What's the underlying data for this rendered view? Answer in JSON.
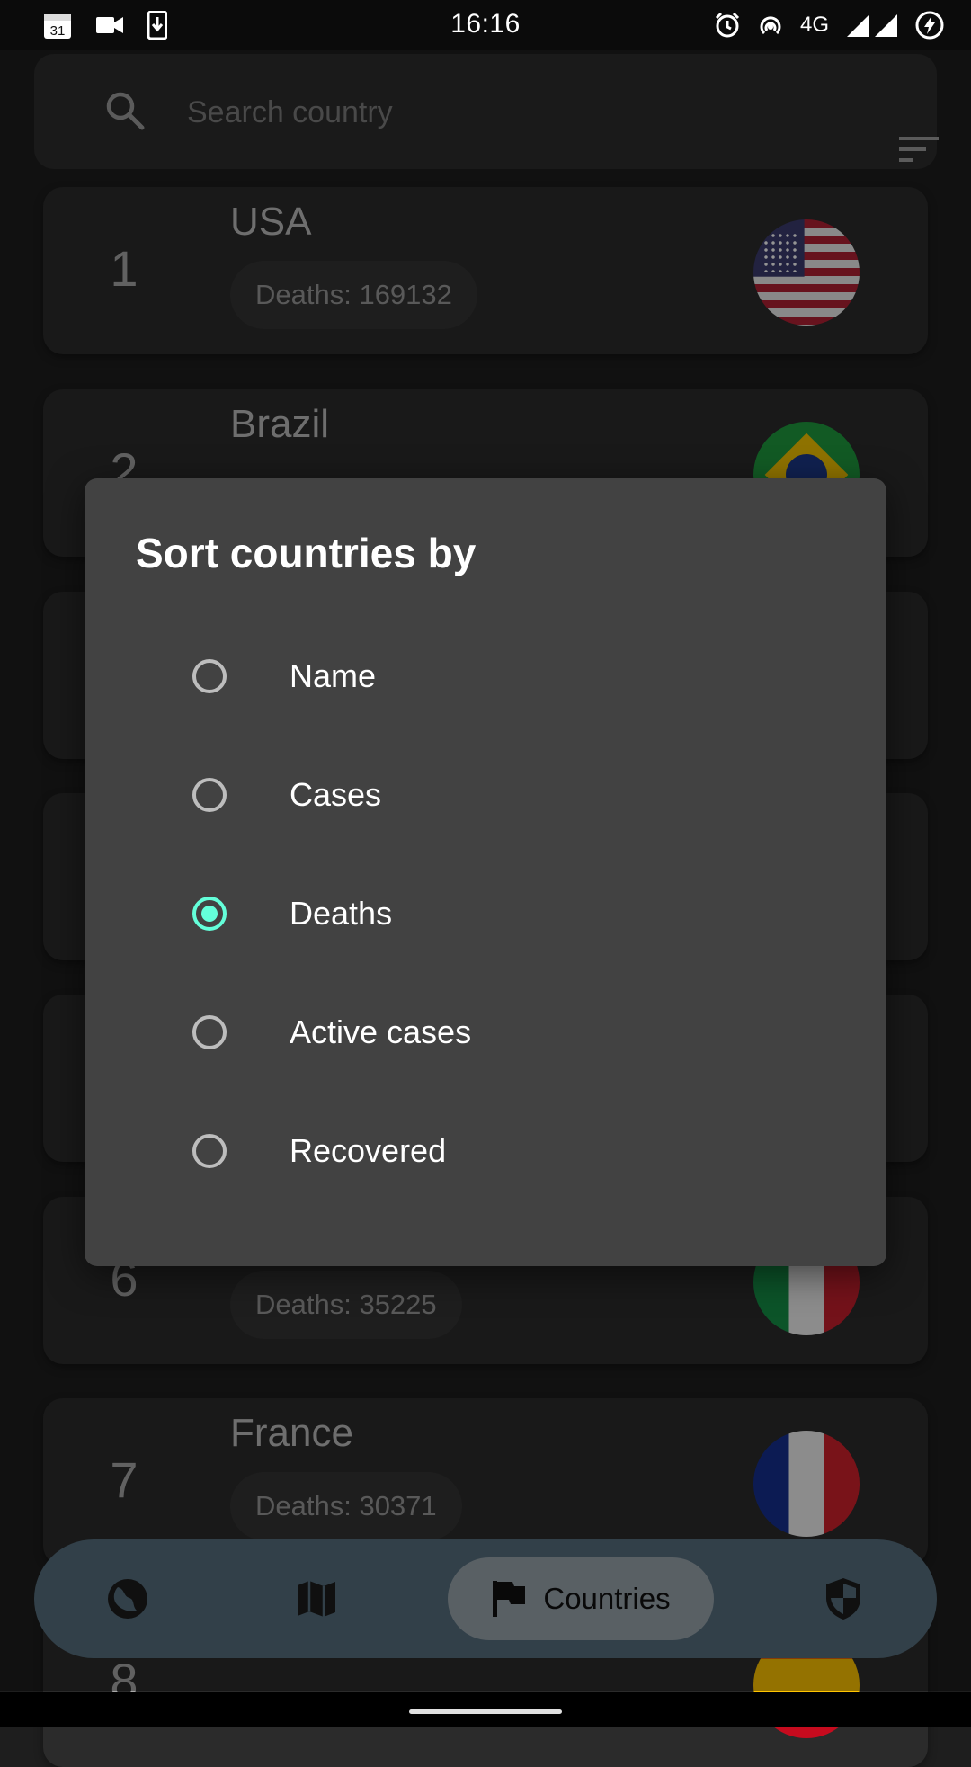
{
  "status_bar": {
    "time": "16:16",
    "calendar_day": "31",
    "network": "4G",
    "left_icons": [
      "calendar-icon",
      "video-icon",
      "download-icon"
    ],
    "right_icons": [
      "alarm-icon",
      "hotspot-icon",
      "signal-icon",
      "battery-charging-icon"
    ]
  },
  "search": {
    "placeholder": "Search country",
    "icon": "search-icon",
    "sort_icon": "sort-icon"
  },
  "countries": [
    {
      "rank": "1",
      "name": "USA",
      "stat": "Deaths: 169132",
      "flag": "usa"
    },
    {
      "rank": "2",
      "name": "Brazil",
      "stat": "",
      "flag": "brazil"
    },
    {
      "rank": "6",
      "name": "",
      "stat": "Deaths: 35225",
      "flag": "italy"
    },
    {
      "rank": "7",
      "name": "France",
      "stat": "Deaths: 30371",
      "flag": "france"
    },
    {
      "rank": "8",
      "name": "",
      "stat": "",
      "flag": "spain"
    }
  ],
  "dialog": {
    "title": "Sort countries by",
    "options": [
      {
        "label": "Name",
        "selected": false
      },
      {
        "label": "Cases",
        "selected": false
      },
      {
        "label": "Deaths",
        "selected": true
      },
      {
        "label": "Active cases",
        "selected": false
      },
      {
        "label": "Recovered",
        "selected": false
      }
    ],
    "accent_color": "#64ffda"
  },
  "bottom_nav": {
    "items": [
      {
        "icon": "globe-icon",
        "label": ""
      },
      {
        "icon": "map-icon",
        "label": ""
      },
      {
        "icon": "flag-icon",
        "label": "Countries",
        "active": true
      },
      {
        "icon": "shield-icon",
        "label": ""
      }
    ]
  }
}
